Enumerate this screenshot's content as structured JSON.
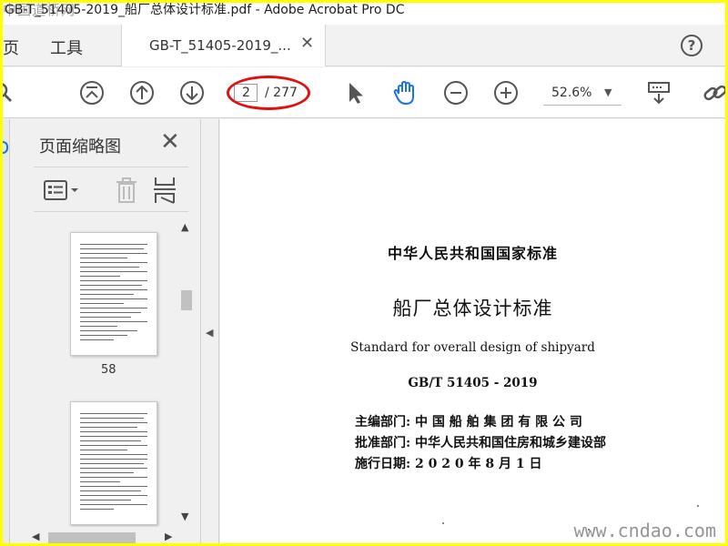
{
  "window": {
    "title": "GB-T_51405-2019_船厂总体设计标准.pdf - Adobe Acrobat Pro DC",
    "watermark_top": "中国道桥网"
  },
  "menu": {
    "home": "页",
    "tools": "工具"
  },
  "tab": {
    "title": "GB-T_51405-2019_...",
    "close": "✕"
  },
  "help": {
    "label": "?"
  },
  "toolbar": {
    "page_current": "2",
    "page_total": "/ 277",
    "zoom": "52.6%"
  },
  "icons": [
    "first-page-icon",
    "prev-page-icon",
    "next-page-icon",
    "select-arrow-icon",
    "hand-tool-icon",
    "zoom-out-icon",
    "zoom-in-icon",
    "scroll-mode-icon",
    "link-icon"
  ],
  "accent_colors": {
    "hand_tool": "#1a73e8",
    "highlight_ellipse": "#e01010",
    "frame": "#ffff00"
  },
  "thumbnail_panel": {
    "title": "页面缩略图",
    "close": "✕",
    "thumbnails": [
      {
        "label": "58"
      },
      {
        "label": ""
      }
    ]
  },
  "document": {
    "heading": "中华人民共和国国家标准",
    "title_cn": "船厂总体设计标准",
    "title_en": "Standard for overall design of shipyard",
    "code": "GB/T 51405 - 2019",
    "lines": [
      {
        "label": "主编部门:",
        "value": "中 国 船 舶 集 团 有 限 公 司"
      },
      {
        "label": "批准部门:",
        "value": "中华人民共和国住房和城乡建设部"
      },
      {
        "label": "施行日期:",
        "value": "2 0 2 0 年 8 月 1 日"
      }
    ]
  },
  "watermark_bottom": "www.cndao.com"
}
